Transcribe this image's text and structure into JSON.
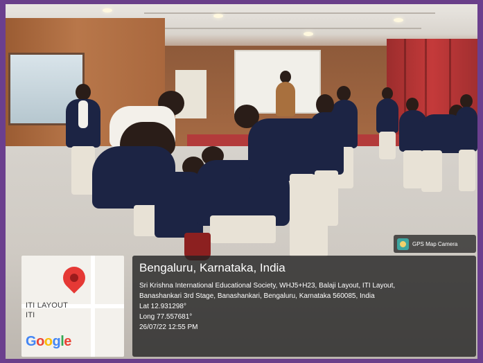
{
  "overlay": {
    "camera_tag": "GPS Map Camera",
    "location_title": "Bengaluru, Karnataka, India",
    "address_line1": "Sri Krishna International Educational Society, WHJ5+H23, Balaji Layout, ITI Layout,",
    "address_line2": "Banashankari 3rd Stage, Banashankari, Bengaluru, Karnataka 560085, India",
    "latitude": "Lat 12.931298°",
    "longitude": "Long 77.557681°",
    "datetime": "26/07/22 12:55 PM"
  },
  "map": {
    "label_line1": "ITI LAYOUT",
    "label_line2": "ITI",
    "brand": "Google",
    "pin_color": "#e53935"
  },
  "colors": {
    "border": "#6b3f8e",
    "blazer": "#1c2444",
    "curtain": "#c43a3a"
  }
}
